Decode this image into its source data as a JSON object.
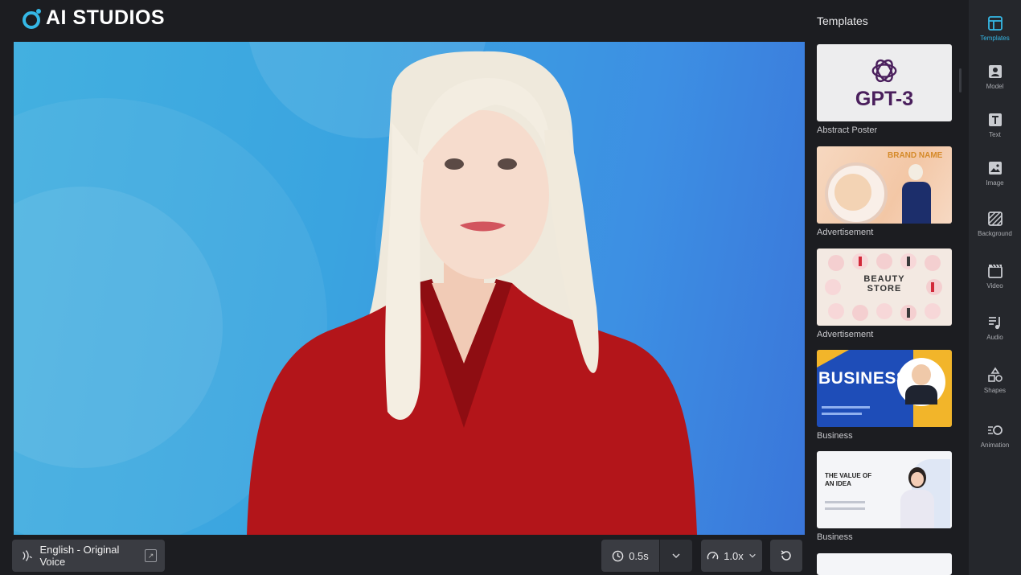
{
  "app": {
    "name": "AI STUDIOS",
    "accent": "#35b8e6"
  },
  "bottom": {
    "voice_label": "English - Original Voice",
    "pause_value": "0.5s",
    "speed_value": "1.0x"
  },
  "templates": {
    "title": "Templates",
    "items": [
      {
        "label": "Abstract Poster",
        "thumb_text": "GPT-3"
      },
      {
        "label": "Advertisement",
        "thumb_text": "BRAND NAME"
      },
      {
        "label": "Advertisement",
        "thumb_text": "BEAUTY STORE"
      },
      {
        "label": "Business",
        "thumb_text": "BUSINESS"
      },
      {
        "label": "Business",
        "thumb_text": "THE VALUE OF AN IDEA"
      }
    ]
  },
  "rail": {
    "items": [
      {
        "label": "Templates",
        "icon": "templates-icon"
      },
      {
        "label": "Model",
        "icon": "model-icon"
      },
      {
        "label": "Text",
        "icon": "text-icon"
      },
      {
        "label": "Image",
        "icon": "image-icon"
      },
      {
        "label": "Background",
        "icon": "background-icon"
      },
      {
        "label": "Video",
        "icon": "video-icon"
      },
      {
        "label": "Audio",
        "icon": "audio-icon"
      },
      {
        "label": "Shapes",
        "icon": "shapes-icon"
      },
      {
        "label": "Animation",
        "icon": "animation-icon"
      }
    ]
  }
}
